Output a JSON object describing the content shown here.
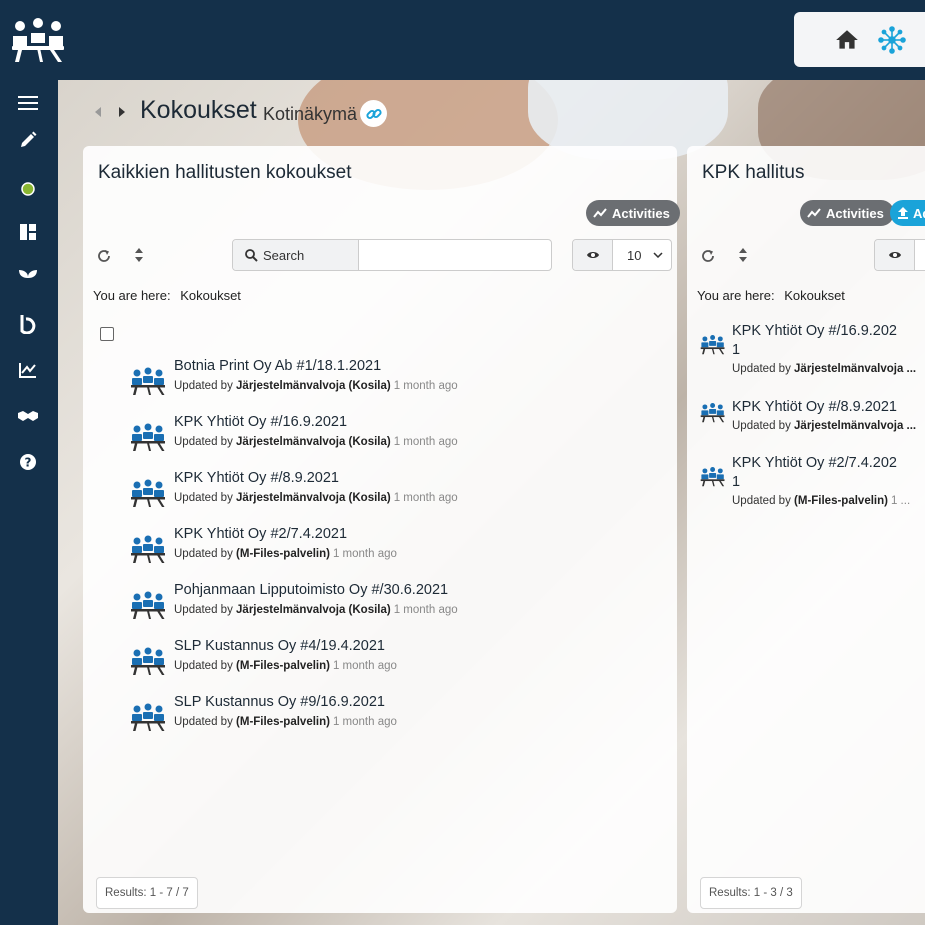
{
  "header": {
    "logo_icon": "meeting-people-logo-icon",
    "home_icon": "home-icon",
    "network_icon": "network-icon"
  },
  "sidebar": {
    "items": [
      {
        "icon": "menu-icon"
      },
      {
        "icon": "pencil-icon"
      },
      {
        "icon": "status-dot-icon",
        "color": "#8ab633"
      },
      {
        "icon": "dashboard-icon"
      },
      {
        "icon": "sprout-icon"
      },
      {
        "icon": "b-logo-icon"
      },
      {
        "icon": "chart-icon"
      },
      {
        "icon": "handshake-icon"
      },
      {
        "icon": "help-icon"
      }
    ]
  },
  "page": {
    "title": "Kokoukset",
    "subtitle": "Kotinäkymä"
  },
  "panels": {
    "left": {
      "title": "Kaikkien hallitusten kokoukset",
      "activities_label": "Activities",
      "search_label": "Search",
      "search_value": "",
      "view_count": "10",
      "breadcrumb_label": "You are here:",
      "breadcrumb_value": "Kokoukset",
      "items": [
        {
          "title": "Botnia Print Oy Ab #1/18.1.2021",
          "updated_by_label": "Updated by",
          "user": "Järjestelmänvalvoja (Kosila)",
          "ago": "1 month ago"
        },
        {
          "title": "KPK Yhtiöt Oy #/16.9.2021",
          "updated_by_label": "Updated by",
          "user": "Järjestelmänvalvoja (Kosila)",
          "ago": "1 month ago"
        },
        {
          "title": "KPK Yhtiöt Oy #/8.9.2021",
          "updated_by_label": "Updated by",
          "user": "Järjestelmänvalvoja (Kosila)",
          "ago": "1 month ago"
        },
        {
          "title": "KPK Yhtiöt Oy #2/7.4.2021",
          "updated_by_label": "Updated by",
          "user": "(M-Files-palvelin)",
          "ago": "1 month ago"
        },
        {
          "title": "Pohjanmaan Lipputoimisto Oy #/30.6.2021",
          "updated_by_label": "Updated by",
          "user": "Järjestelmänvalvoja (Kosila)",
          "ago": "1 month ago"
        },
        {
          "title": "SLP Kustannus Oy #4/19.4.2021",
          "updated_by_label": "Updated by",
          "user": "(M-Files-palvelin)",
          "ago": "1 month ago"
        },
        {
          "title": "SLP Kustannus Oy #9/16.9.2021",
          "updated_by_label": "Updated by",
          "user": "(M-Files-palvelin)",
          "ago": "1 month ago"
        }
      ],
      "results": "Results: 1 - 7 / 7"
    },
    "right": {
      "title": "KPK hallitus",
      "activities_label": "Activities",
      "add_label": "Ad",
      "breadcrumb_label": "You are here:",
      "breadcrumb_value": "Kokoukset",
      "items": [
        {
          "title_line1": "KPK Yhtiöt Oy #/16.9.202",
          "title_line2": "1",
          "updated_by_label": "Updated by",
          "user": "Järjestelmänvalvoja ..."
        },
        {
          "title_line1": "KPK Yhtiöt Oy #/8.9.2021",
          "title_line2": "",
          "updated_by_label": "Updated by",
          "user": "Järjestelmänvalvoja ..."
        },
        {
          "title_line1": "KPK Yhtiöt Oy #2/7.4.202",
          "title_line2": "1",
          "updated_by_label": "Updated by",
          "user": "(M-Files-palvelin)",
          "ago": "1 ..."
        }
      ],
      "results": "Results: 1 - 3 / 3"
    }
  }
}
